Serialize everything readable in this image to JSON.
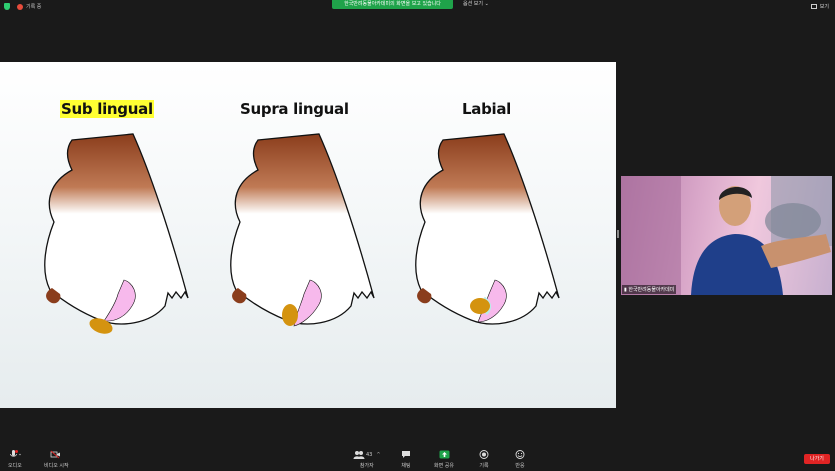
{
  "topbar": {
    "recording_label": "기록 중",
    "banner": "한국반려동물아카데미의 화면을 보고 있습니다",
    "view_options": "옵션 보기 ⌄",
    "view_button": "보기"
  },
  "slide": {
    "titles": [
      "Sub lingual",
      "Supra lingual",
      "Labial"
    ]
  },
  "video": {
    "participant_name": "한국반려동물아카데미"
  },
  "toolbar": {
    "audio": "오디오",
    "video": "비디오 시작",
    "participants": "참가자",
    "participants_count": "43",
    "chat": "채팅",
    "share": "화면 공유",
    "record": "기록",
    "reactions": "반응",
    "leave": "나가기"
  },
  "colors": {
    "share_green": "#1fa34a",
    "leave_red": "#e02424",
    "fur_brown": "#8a3d1c",
    "tongue_pink": "#f7b9ec",
    "pill_orange": "#d4930f",
    "highlight": "#ffff33"
  }
}
